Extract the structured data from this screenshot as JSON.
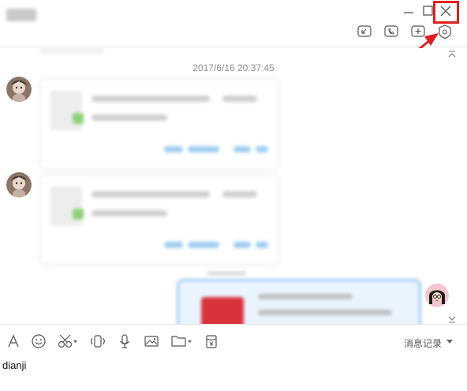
{
  "window": {
    "contact_name": "",
    "buttons": [
      "minimize",
      "maximize",
      "close"
    ]
  },
  "title_toolbar": {
    "icons": [
      "screen-share-icon",
      "phone-icon",
      "add-icon",
      "settings-shield-icon"
    ]
  },
  "annotation": {
    "highlight": "close-button",
    "arrow_color": "#e02020"
  },
  "chat": {
    "timestamp": "2017/6/16 20:37:45",
    "messages": [
      {
        "side": "left",
        "type": "file-card",
        "blurred": true
      },
      {
        "side": "left",
        "type": "file-card",
        "blurred": true
      },
      {
        "side": "right",
        "type": "file-card",
        "blurred": true
      }
    ]
  },
  "toolbar": {
    "tools": [
      "font-icon",
      "emoji-icon",
      "screenshot-scissors-icon",
      "shake-icon",
      "voice-icon",
      "image-icon",
      "folder-icon",
      "red-packet-icon"
    ],
    "history_label": "消息记录"
  },
  "input": {
    "value": "dianji"
  }
}
